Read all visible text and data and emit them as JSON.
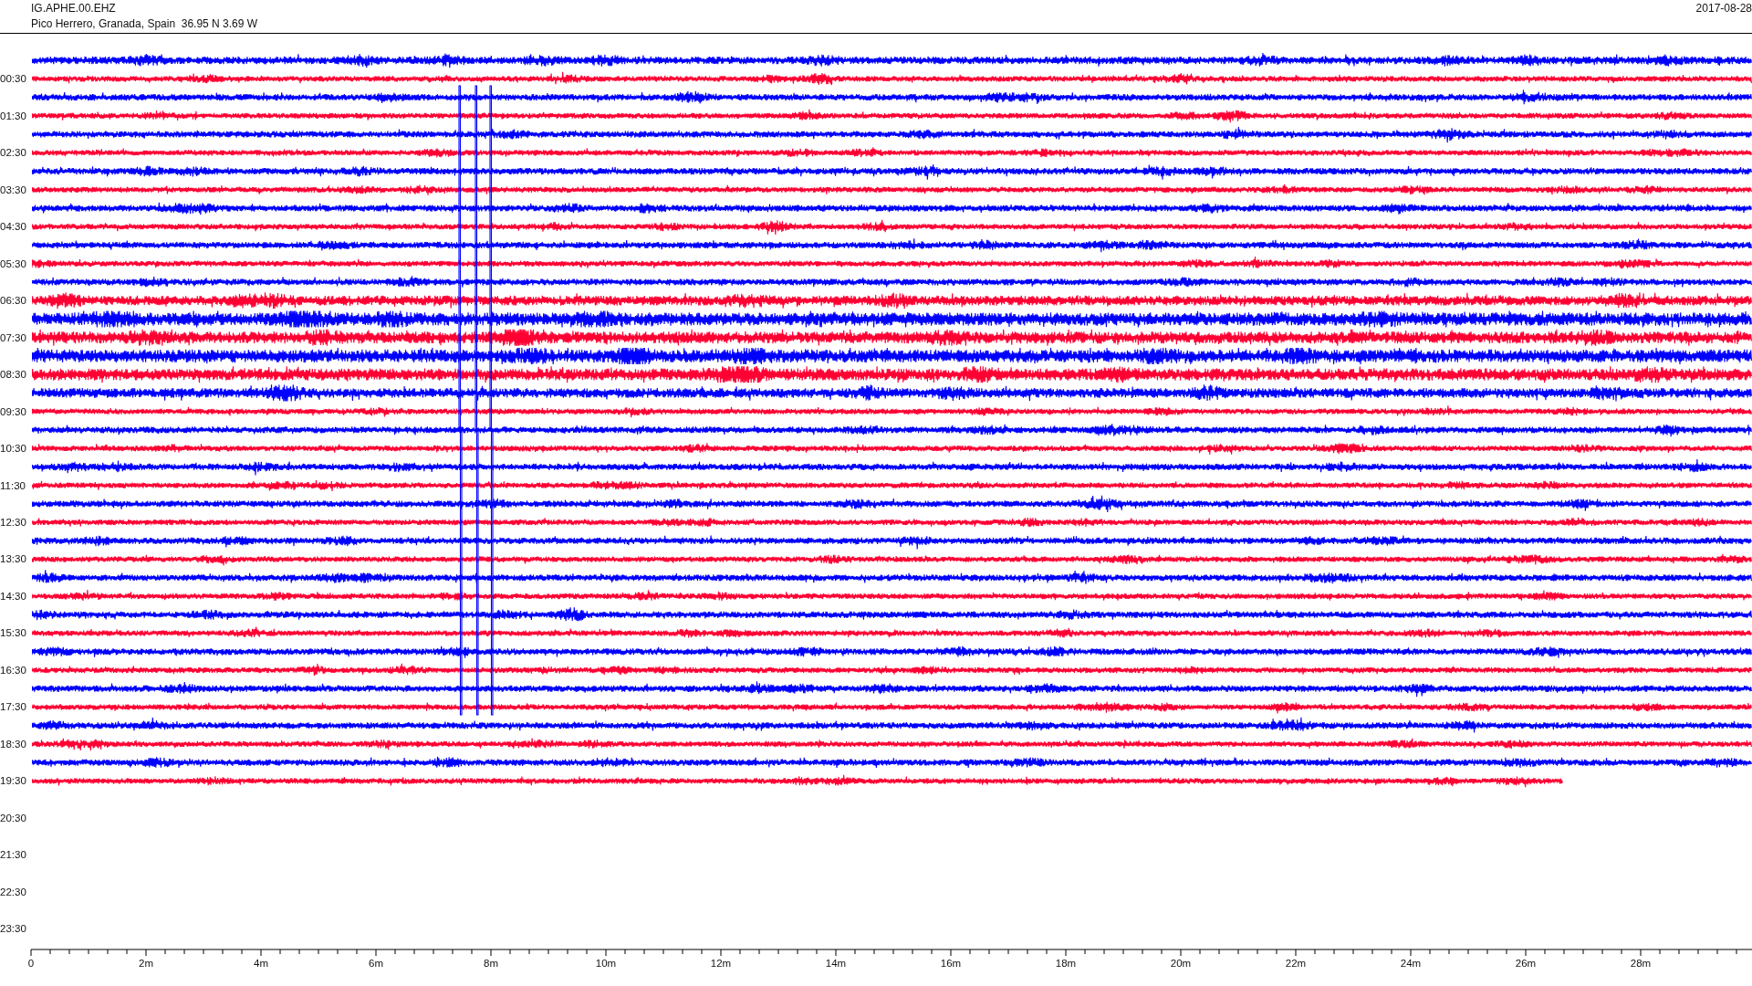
{
  "header": {
    "station": "IG.APHE.00.EHZ",
    "location": "Pico Herrero, Granada, Spain  36.95 N 3.69 W",
    "date": "2017-08-28"
  },
  "hour_labels": [
    "00:30",
    "01:30",
    "02:30",
    "03:30",
    "04:30",
    "05:30",
    "06:30",
    "07:30",
    "08:30",
    "09:30",
    "10:30",
    "11:30",
    "12:30",
    "13:30",
    "14:30",
    "15:30",
    "16:30",
    "17:30",
    "18:30",
    "19:30",
    "20:30",
    "21:30",
    "22:30",
    "23:30"
  ],
  "traces": [
    {
      "color": "#0000ff"
    },
    {
      "color": "#ff0033"
    },
    {
      "color": "#0000ff"
    },
    {
      "color": "#ff0033"
    },
    {
      "color": "#0000ff"
    },
    {
      "color": "#ff0033"
    },
    {
      "color": "#0000ff"
    },
    {
      "color": "#ff0033"
    },
    {
      "color": "#0000ff"
    },
    {
      "color": "#ff0033"
    },
    {
      "color": "#0000ff"
    },
    {
      "color": "#ff0033"
    },
    {
      "color": "#0000ff"
    },
    {
      "color": "#ff0033"
    },
    {
      "color": "#0000ff"
    },
    {
      "color": "#ff0033"
    },
    {
      "color": "#0000ff"
    },
    {
      "color": "#ff0033"
    },
    {
      "color": "#0000ff"
    },
    {
      "color": "#ff0033"
    },
    {
      "color": "#0000ff"
    },
    {
      "color": "#ff0033"
    },
    {
      "color": "#0000ff"
    },
    {
      "color": "#ff0033"
    },
    {
      "color": "#0000ff"
    },
    {
      "color": "#ff0033"
    },
    {
      "color": "#0000ff"
    },
    {
      "color": "#ff0033"
    },
    {
      "color": "#0000ff"
    },
    {
      "color": "#ff0033"
    },
    {
      "color": "#0000ff"
    },
    {
      "color": "#ff0033"
    },
    {
      "color": "#0000ff"
    },
    {
      "color": "#ff0033"
    },
    {
      "color": "#0000ff"
    },
    {
      "color": "#ff0033"
    },
    {
      "color": "#0000ff"
    },
    {
      "color": "#ff0033"
    },
    {
      "color": "#0000ff"
    },
    {
      "color": "#ff0033"
    }
  ],
  "axis": {
    "ticks": [
      "0",
      "2m",
      "4m",
      "6m",
      "8m",
      "10m",
      "12m",
      "14m",
      "16m",
      "18m",
      "20m",
      "22m",
      "24m",
      "26m",
      "28m"
    ]
  }
}
